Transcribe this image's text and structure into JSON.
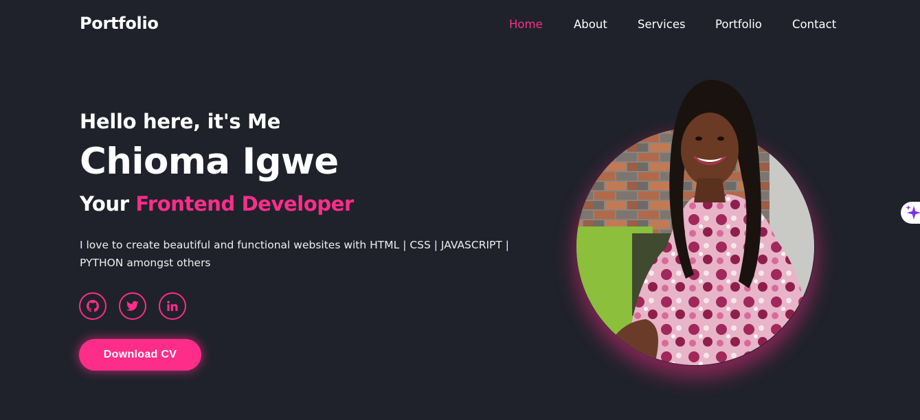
{
  "header": {
    "logo": "Portfolio",
    "nav": [
      {
        "label": "Home",
        "active": true
      },
      {
        "label": "About",
        "active": false
      },
      {
        "label": "Services",
        "active": false
      },
      {
        "label": "Portfolio",
        "active": false
      },
      {
        "label": "Contact",
        "active": false
      }
    ]
  },
  "hero": {
    "greeting": "Hello here, it's Me",
    "name": "Chioma Igwe",
    "role_prefix": "Your ",
    "role_highlight": "Frontend Developer",
    "description": "I love to create beautiful and functional websites with HTML | CSS | JAVASCRIPT | PYTHON amongst others",
    "social_icons": [
      "github-icon",
      "twitter-icon",
      "linkedin-icon"
    ],
    "cta_label": "Download CV"
  },
  "colors": {
    "background": "#1f222b",
    "accent": "#ff2d8a",
    "text": "#ffffff"
  },
  "floating_badge_icon": "sparkle-icon"
}
